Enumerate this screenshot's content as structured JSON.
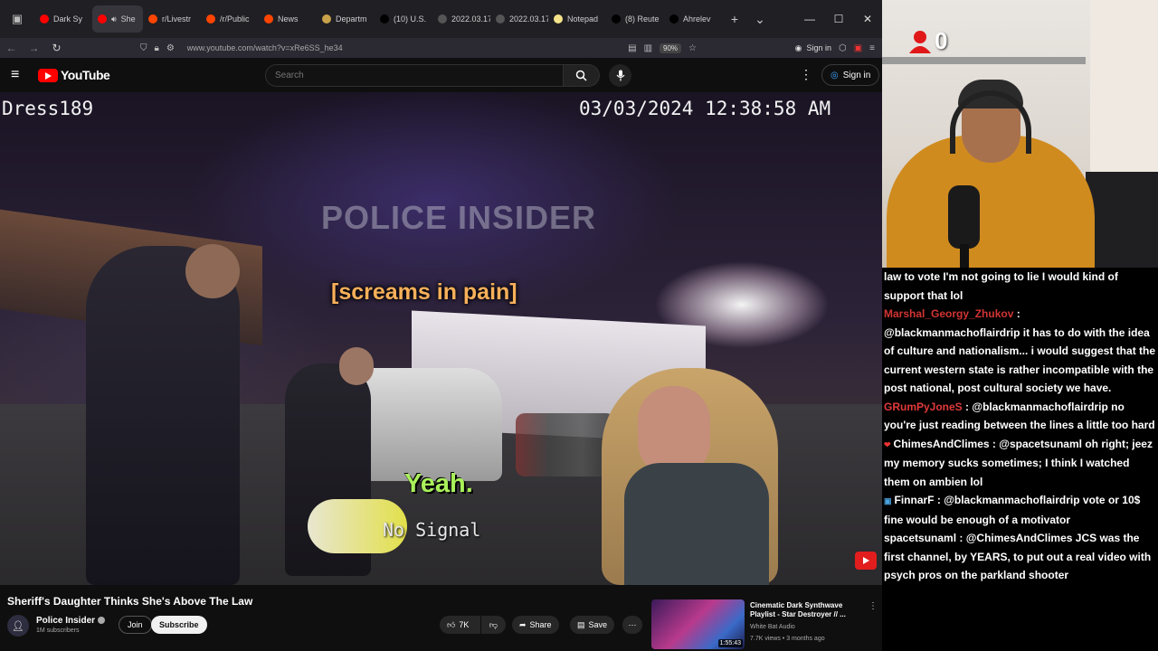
{
  "browser": {
    "tabs": [
      {
        "label": "Dark Sy",
        "fav_color": "#ff0000",
        "active": false
      },
      {
        "label": "She",
        "fav_color": "#ff0000",
        "active": true
      },
      {
        "label": "r/Livestr",
        "fav_color": "#ff4500",
        "active": false
      },
      {
        "label": "/r/Public",
        "fav_color": "#ff4500",
        "active": false
      },
      {
        "label": "News",
        "fav_color": "#ff4500",
        "active": false
      },
      {
        "label": "Departm",
        "fav_color": "#c8a24a",
        "active": false
      },
      {
        "label": "(10) U.S.",
        "fav_color": "#000000",
        "active": false
      },
      {
        "label": "2022.03.17-",
        "fav_color": "#555555",
        "active": false
      },
      {
        "label": "2022.03.17-",
        "fav_color": "#555555",
        "active": false
      },
      {
        "label": "Notepad",
        "fav_color": "#f5e38a",
        "active": false
      },
      {
        "label": "(8) Reute",
        "fav_color": "#000000",
        "active": false
      },
      {
        "label": "Ahrelev",
        "fav_color": "#000000",
        "active": false
      }
    ],
    "url": "www.youtube.com/watch?v=xRe6SS_he34",
    "zoom": "90%",
    "signin_label": "Sign in"
  },
  "youtube": {
    "logo_text": "YouTube",
    "search_placeholder": "Search",
    "signin_label": "Sign in"
  },
  "video": {
    "osd_left": "Dress189",
    "osd_right": "03/03/2024 12:38:58 AM",
    "watermark": "POLICE INSIDER",
    "caption_top": "[screams in pain]",
    "caption_yeah": "Yeah.",
    "no_signal": "No Signal"
  },
  "below_video": {
    "title": "Sheriff's Daughter Thinks She's Above The Law",
    "channel_name": "Police Insider",
    "subscribers": "1M subscribers",
    "join_label": "Join",
    "subscribe_label": "Subscribe",
    "likes": "7K",
    "share_label": "Share",
    "save_label": "Save"
  },
  "related": {
    "title": "Cinematic Dark Synthwave Playlist - Star Destroyer // ...",
    "channel": "White Bat Audio",
    "meta": "7.7K views • 3 months ago",
    "duration": "1:55:43"
  },
  "stream": {
    "counter": "0",
    "chat": [
      {
        "name": "",
        "name_color": "#ffffff",
        "badge": "",
        "text": "law to vote I'm not going to lie I would kind of support that lol"
      },
      {
        "name": "Marshal_Georgy_Zhukov",
        "name_color": "#d23434",
        "badge": "",
        "text": "@blackmanmachoflairdrip it has to do with the idea of culture and nationalism... i would suggest that the current western state is rather incompatible with the post national, post cultural society we have."
      },
      {
        "name": "GRumPyJoneS",
        "name_color": "#e03a3a",
        "badge": "",
        "text": "@blackmanmachoflairdrip no you're just reading between the lines a little too hard"
      },
      {
        "name": "ChimesAndClimes",
        "name_color": "#ffffff",
        "badge": "❤",
        "text": "@spacetsunaml oh right; jeez my memory sucks sometimes; I think I watched them on ambien lol"
      },
      {
        "name": "FinnarF",
        "name_color": "#ffffff",
        "badge": "▣",
        "text": "@blackmanmachoflairdrip vote or 10$ fine would be enough of a motivator"
      },
      {
        "name": "spacetsunaml",
        "name_color": "#ffffff",
        "badge": "",
        "text": "@ChimesAndClimes JCS was the first channel, by YEARS, to put out a real video with psych pros on the parkland shooter"
      }
    ]
  }
}
